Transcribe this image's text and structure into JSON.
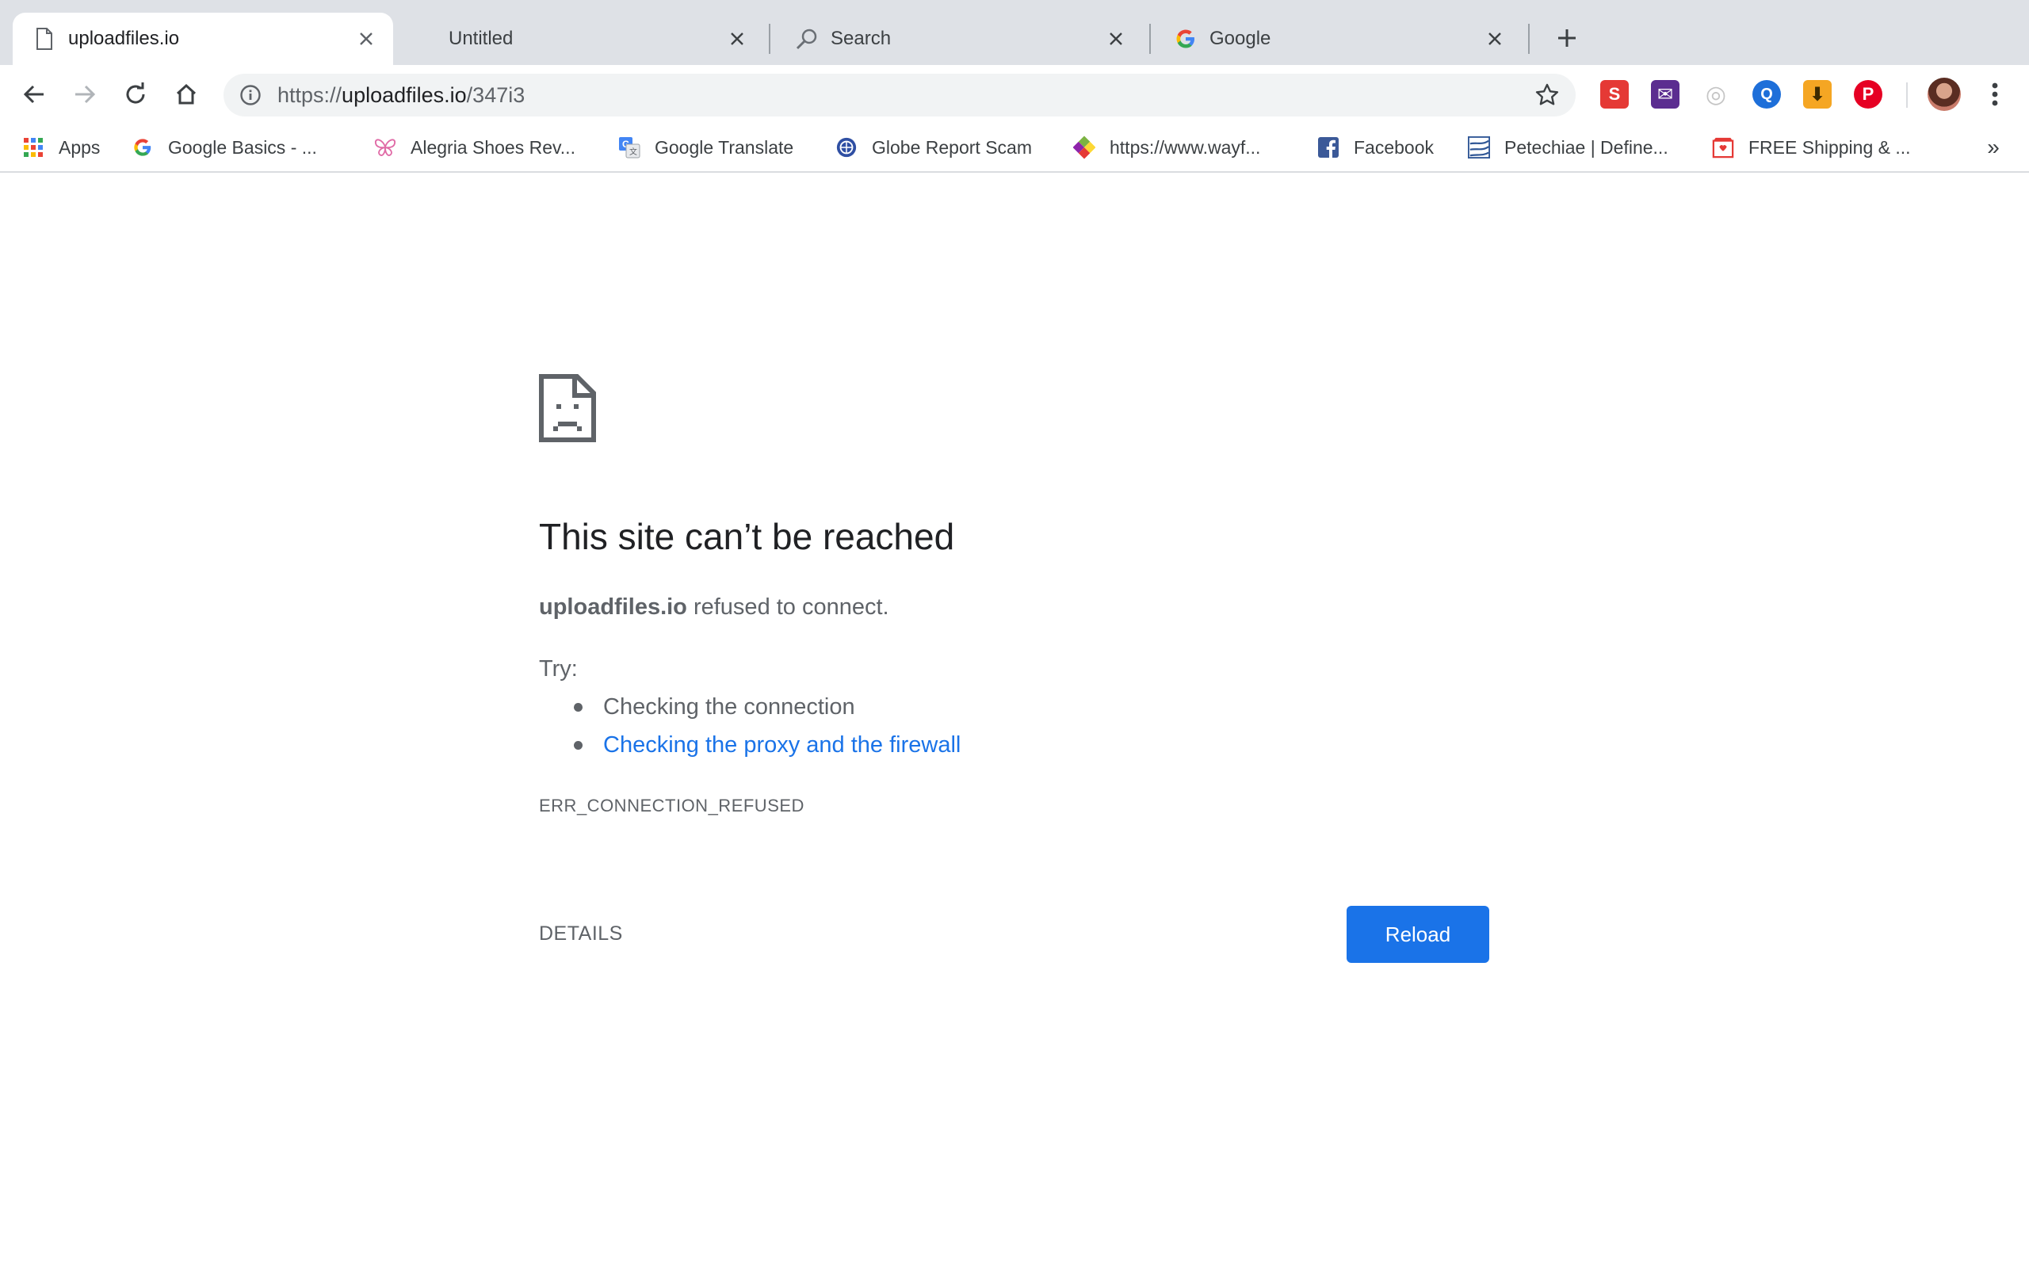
{
  "tabs": [
    {
      "title": "uploadfiles.io",
      "icon": "document-icon",
      "active": true
    },
    {
      "title": "Untitled",
      "icon": "none",
      "active": false
    },
    {
      "title": "Search",
      "icon": "magnifier-icon",
      "active": false
    },
    {
      "title": "Google",
      "icon": "google-g-icon",
      "active": false
    }
  ],
  "toolbar": {
    "url_scheme": "https://",
    "url_host": "uploadfiles.io",
    "url_path": "/347i3"
  },
  "extensions": [
    {
      "name": "s-extension-icon",
      "label": "S",
      "color": "#e53935"
    },
    {
      "name": "mail-extension-icon",
      "label": "✉",
      "color": "#5b2d90"
    },
    {
      "name": "circle-extension-icon",
      "label": "◎",
      "color": "#c5c5c5"
    },
    {
      "name": "search-extension-icon",
      "label": "Q",
      "color": "#1e6fd9"
    },
    {
      "name": "download-extension-icon",
      "label": "⬇",
      "color": "#f5a623"
    },
    {
      "name": "pinterest-icon",
      "label": "P",
      "color": "#e60023"
    }
  ],
  "bookmarks": [
    {
      "label": "Apps",
      "icon": "apps-grid-icon"
    },
    {
      "label": "Google Basics - ...",
      "icon": "google-g-icon"
    },
    {
      "label": "Alegria Shoes Rev...",
      "icon": "butterfly-icon"
    },
    {
      "label": "Google Translate",
      "icon": "translate-icon"
    },
    {
      "label": "Globe Report Scam",
      "icon": "globe-icon"
    },
    {
      "label": "https://www.wayf...",
      "icon": "wayfair-icon"
    },
    {
      "label": "Facebook",
      "icon": "facebook-icon"
    },
    {
      "label": "Petechiae | Define...",
      "icon": "dictionary-icon"
    },
    {
      "label": "FREE Shipping & ...",
      "icon": "shop-icon"
    }
  ],
  "bookmarks_more": "»",
  "error": {
    "title": "This site can’t be reached",
    "host": "uploadfiles.io",
    "summary_rest": " refused to connect.",
    "try_label": "Try:",
    "suggestions": [
      "Checking the connection",
      "Checking the proxy and the firewall"
    ],
    "code": "ERR_CONNECTION_REFUSED",
    "details_label": "DETAILS",
    "reload_label": "Reload"
  },
  "colors": {
    "accent": "#1a73e8",
    "link": "#1a73e8",
    "tabstrip": "#dee1e6"
  }
}
